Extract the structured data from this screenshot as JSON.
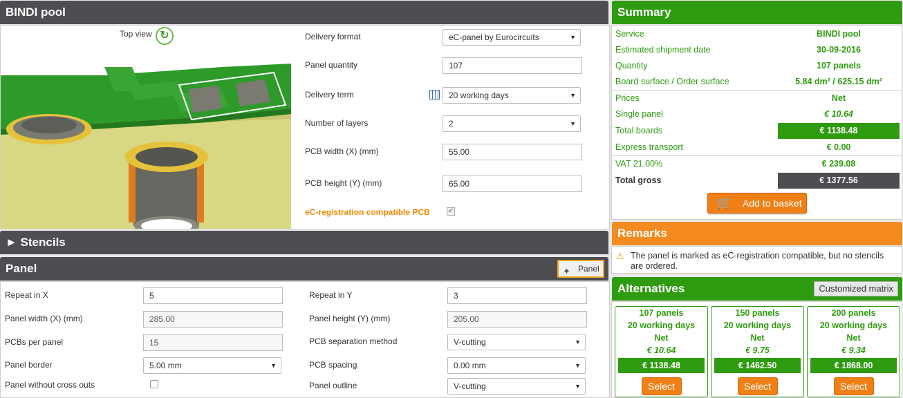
{
  "product": {
    "title": "BINDI pool",
    "top_view_label": "Top view",
    "fields": [
      {
        "label": "Delivery format",
        "value": "eC-panel by Eurocircuits",
        "type": "select"
      },
      {
        "label": "Panel quantity",
        "value": "107",
        "type": "input"
      },
      {
        "label": "Delivery term",
        "value": "20 working days",
        "type": "select"
      },
      {
        "label": "Number of layers",
        "value": "2",
        "type": "select"
      },
      {
        "label": "PCB width (X) (mm)",
        "value": "55.00",
        "type": "input"
      },
      {
        "label": "PCB height (Y) (mm)",
        "value": "65.00",
        "type": "input"
      },
      {
        "label": "eC-registration compatible PCB",
        "value": "",
        "type": "checkbox"
      }
    ]
  },
  "stencils": {
    "title": "► Stencils"
  },
  "panel": {
    "title": "Panel",
    "button_label": "Panel",
    "left_fields": [
      {
        "label": "Repeat in X",
        "value": "5"
      },
      {
        "label": "Panel width (X) (mm)",
        "value": "285.00"
      },
      {
        "label": "PCBs per panel",
        "value": "15"
      },
      {
        "label": "Panel border",
        "value": "5.00 mm"
      },
      {
        "label": "Panel without cross outs",
        "value": ""
      }
    ],
    "right_fields": [
      {
        "label": "Repeat in Y",
        "value": "3"
      },
      {
        "label": "Panel height (Y) (mm)",
        "value": "205.00"
      },
      {
        "label": "PCB separation method",
        "value": "V-cutting"
      },
      {
        "label": "PCB spacing",
        "value": "0.00 mm"
      },
      {
        "label": "Panel outline",
        "value": "V-cutting"
      }
    ]
  },
  "summary": {
    "title": "Summary",
    "service_label": "Service",
    "service_value": "BINDI pool",
    "ship_label": "Estimated shipment date",
    "ship_value": "30-09-2016",
    "qty_label": "Quantity",
    "qty_value": "107 panels",
    "surface_label": "Board surface / Order surface",
    "surface_value": "5.84 dm² / 625.15 dm²",
    "prices_label": "Prices",
    "prices_value": "Net",
    "single_label": "Single panel",
    "single_value": "€ 10.64",
    "total_boards_label": "Total boards",
    "total_boards_value": "€ 1138.48",
    "express_label": "Express transport",
    "express_value": "€ 0.00",
    "vat_label": "VAT 21.00%",
    "vat_value": "€ 239.08",
    "gross_label": "Total gross",
    "gross_value": "€ 1377.56",
    "basket_label": "Add to basket"
  },
  "remarks": {
    "title": "Remarks",
    "text": "The panel is marked as eC-registration compatible, but no stencils are ordered."
  },
  "alternatives": {
    "title": "Alternatives",
    "matrix_label": "Customized matrix",
    "items": [
      {
        "qty": "107 panels",
        "term": "20 working days",
        "basis": "Net",
        "unit": "€ 10.64",
        "total": "€ 1138.48",
        "select": "Select"
      },
      {
        "qty": "150 panels",
        "term": "20 working days",
        "basis": "Net",
        "unit": "€ 9.75",
        "total": "€ 1462.50",
        "select": "Select"
      },
      {
        "qty": "200 panels",
        "term": "20 working days",
        "basis": "Net",
        "unit": "€ 9.34",
        "total": "€ 1868.00",
        "select": "Select"
      }
    ]
  },
  "colors": {
    "green": "#2f9b10",
    "orange": "#f58b1f",
    "dark": "#4d4d52"
  }
}
